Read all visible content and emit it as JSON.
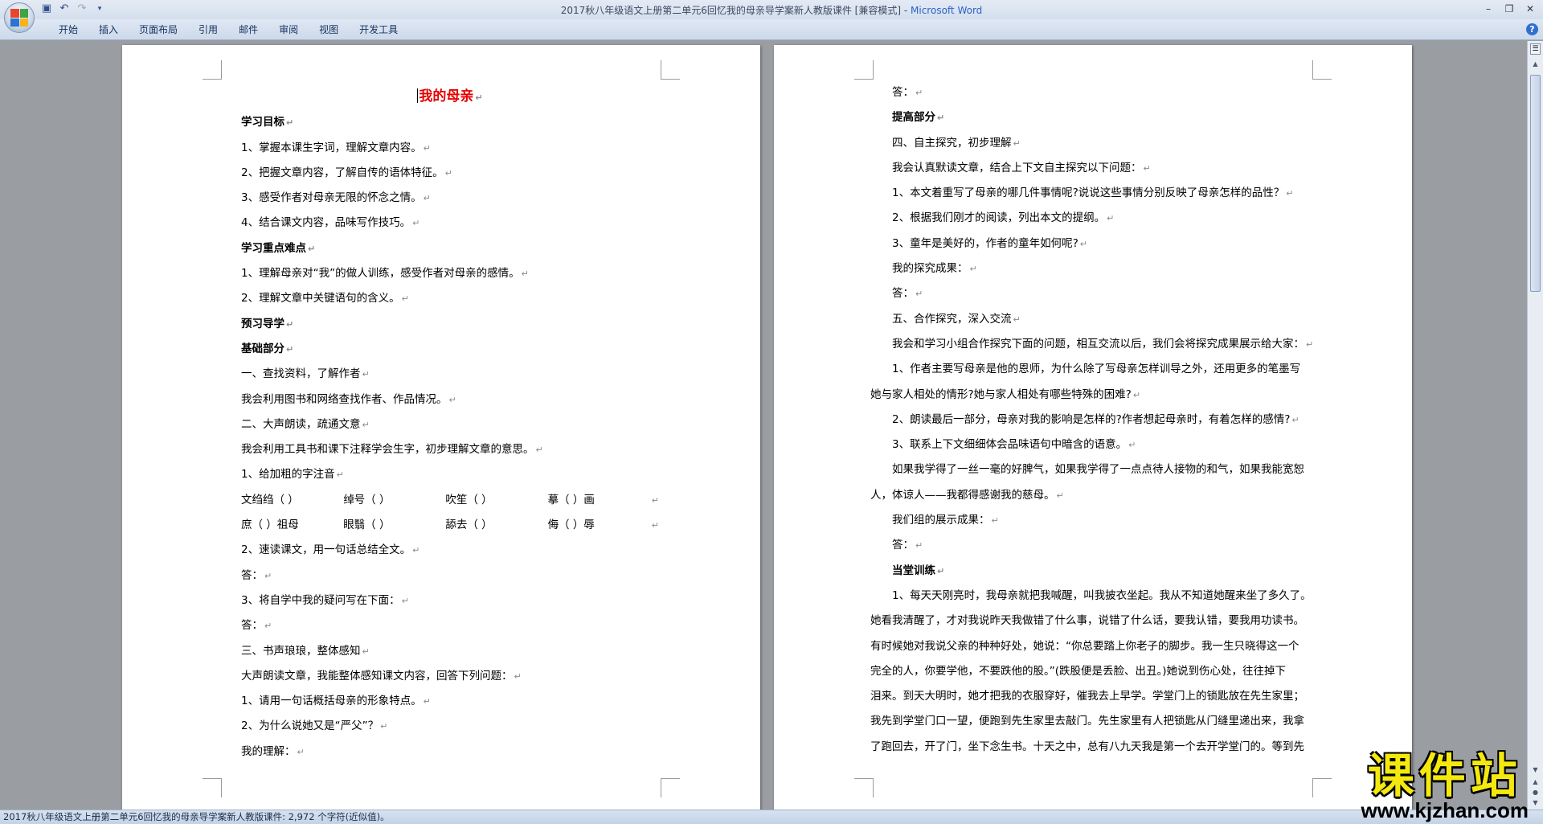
{
  "window": {
    "title": "2017秋八年级语文上册第二单元6回忆我的母亲导学案新人教版课件 [兼容模式] - ",
    "app_name": "Microsoft Word"
  },
  "quick_access": [
    "save-icon",
    "undo-icon",
    "redo-icon",
    "customize-icon"
  ],
  "ribbon_tabs": [
    "开始",
    "插入",
    "页面布局",
    "引用",
    "邮件",
    "审阅",
    "视图",
    "开发工具"
  ],
  "left_page": {
    "title": "我的母亲",
    "lines": [
      {
        "text": "学习目标",
        "bold": true
      },
      {
        "text": "1、掌握本课生字词，理解文章内容。"
      },
      {
        "text": "2、把握文章内容，了解自传的语体特征。"
      },
      {
        "text": "3、感受作者对母亲无限的怀念之情。"
      },
      {
        "text": "4、结合课文内容，品味写作技巧。"
      },
      {
        "text": "学习重点难点",
        "bold": true
      },
      {
        "text": "1、理解母亲对“我”的做人训练，感受作者对母亲的感情。"
      },
      {
        "text": "2、理解文章中关键语句的含义。"
      },
      {
        "text": "预习导学",
        "bold": true
      },
      {
        "text": "基础部分",
        "bold": true
      },
      {
        "text": "一、查找资料，了解作者"
      },
      {
        "text": "我会利用图书和网络查找作者、作品情况。"
      },
      {
        "text": "二、大声朗读，疏通文意"
      },
      {
        "text": "我会利用工具书和课下注释学会生字，初步理解文章的意思。"
      },
      {
        "text": "1、给加粗的字注音"
      }
    ],
    "pinyin_rows": [
      [
        "文绉绉（    ）",
        "绰号（    ）",
        "吹笙（    ）",
        "摹（    ）画"
      ],
      [
        "庶（    ）祖母",
        "眼翳（    ）",
        "舔去（    ）",
        "侮（    ）辱"
      ]
    ],
    "lines_after": [
      {
        "text": "2、速读课文，用一句话总结全文。"
      },
      {
        "text": "答："
      },
      {
        "text": "3、将自学中我的疑问写在下面："
      },
      {
        "text": "答："
      },
      {
        "text": "三、书声琅琅，整体感知"
      },
      {
        "text": "大声朗读文章，我能整体感知课文内容，回答下列问题："
      },
      {
        "text": "1、请用一句话概括母亲的形象特点。"
      },
      {
        "text": "2、为什么说她又是“严父”？"
      },
      {
        "text": "我的理解："
      }
    ]
  },
  "right_page": {
    "lines": [
      {
        "text": "答：",
        "indent": true
      },
      {
        "text": "提高部分",
        "bold": true,
        "indent": true
      },
      {
        "text": "四、自主探究，初步理解",
        "indent": true
      },
      {
        "text": "我会认真默读文章，结合上下文自主探究以下问题：",
        "indent": true
      },
      {
        "text": "1、本文着重写了母亲的哪几件事情呢?说说这些事情分别反映了母亲怎样的品性？",
        "indent": true
      },
      {
        "text": "2、根据我们刚才的阅读，列出本文的提纲。",
        "indent": true
      },
      {
        "text": "3、童年是美好的，作者的童年如何呢?",
        "indent": true
      },
      {
        "text": "我的探究成果：",
        "indent": true
      },
      {
        "text": "答：",
        "indent": true
      },
      {
        "text": "五、合作探究，深入交流",
        "indent": true
      },
      {
        "text": "我会和学习小组合作探究下面的问题，相互交流以后，我们会将探究成果展示给大家：",
        "indent": true
      },
      {
        "text": "1、作者主要写母亲是他的恩师，为什么除了写母亲怎样训导之外，还用更多的笔墨写",
        "indent": true,
        "nomark": true
      },
      {
        "text": "她与家人相处的情形?她与家人相处有哪些特殊的困难?"
      },
      {
        "text": "2、朗读最后一部分，母亲对我的影响是怎样的?作者想起母亲时，有着怎样的感情?",
        "indent": true
      },
      {
        "text": "3、联系上下文细细体会品味语句中暗含的语意。",
        "indent": true
      },
      {
        "text": "如果我学得了一丝一毫的好脾气，如果我学得了一点点待人接物的和气，如果我能宽恕",
        "indent": true,
        "nomark": true
      },
      {
        "text": "人，体谅人——我都得感谢我的慈母。"
      },
      {
        "text": "我们组的展示成果：",
        "indent": true
      },
      {
        "text": "答：",
        "indent": true
      },
      {
        "text": "当堂训练",
        "bold": true,
        "indent": true
      },
      {
        "text": "1、每天天刚亮时，我母亲就把我喊醒，叫我披衣坐起。我从不知道她醒来坐了多久了。",
        "indent": true,
        "nomark": true
      },
      {
        "text": "她看我清醒了，才对我说昨天我做错了什么事，说错了什么话，要我认错，要我用功读书。",
        "nomark": true
      },
      {
        "text": "有时候她对我说父亲的种种好处，她说：“你总要踏上你老子的脚步。我一生只晓得这一个",
        "nomark": true
      },
      {
        "text": "完全的人，你要学他，不要跌他的股。”(跌股便是丢脸、出丑。)她说到伤心处，往往掉下",
        "nomark": true
      },
      {
        "text": "泪来。到天大明时，她才把我的衣服穿好，催我去上早学。学堂门上的锁匙放在先生家里；",
        "nomark": true
      },
      {
        "text": "我先到学堂门口一望，便跑到先生家里去敲门。先生家里有人把锁匙从门缝里递出来，我拿",
        "nomark": true
      },
      {
        "text": "了跑回去，开了门，坐下念生书。十天之中，总有八九天我是第一个去开学堂门的。等到先",
        "nomark": true
      }
    ]
  },
  "status_bar": {
    "text": "2017秋八年级语文上册第二单元6回忆我的母亲导学案新人教版课件: 2,972 个字符(近似值)。"
  },
  "watermark": {
    "main": "课件站",
    "url": "www.kjzhan.com"
  },
  "colors": {
    "title_red": "#e60000",
    "workspace": "#9a9da2",
    "watermark_yellow": "#f4e90f"
  }
}
